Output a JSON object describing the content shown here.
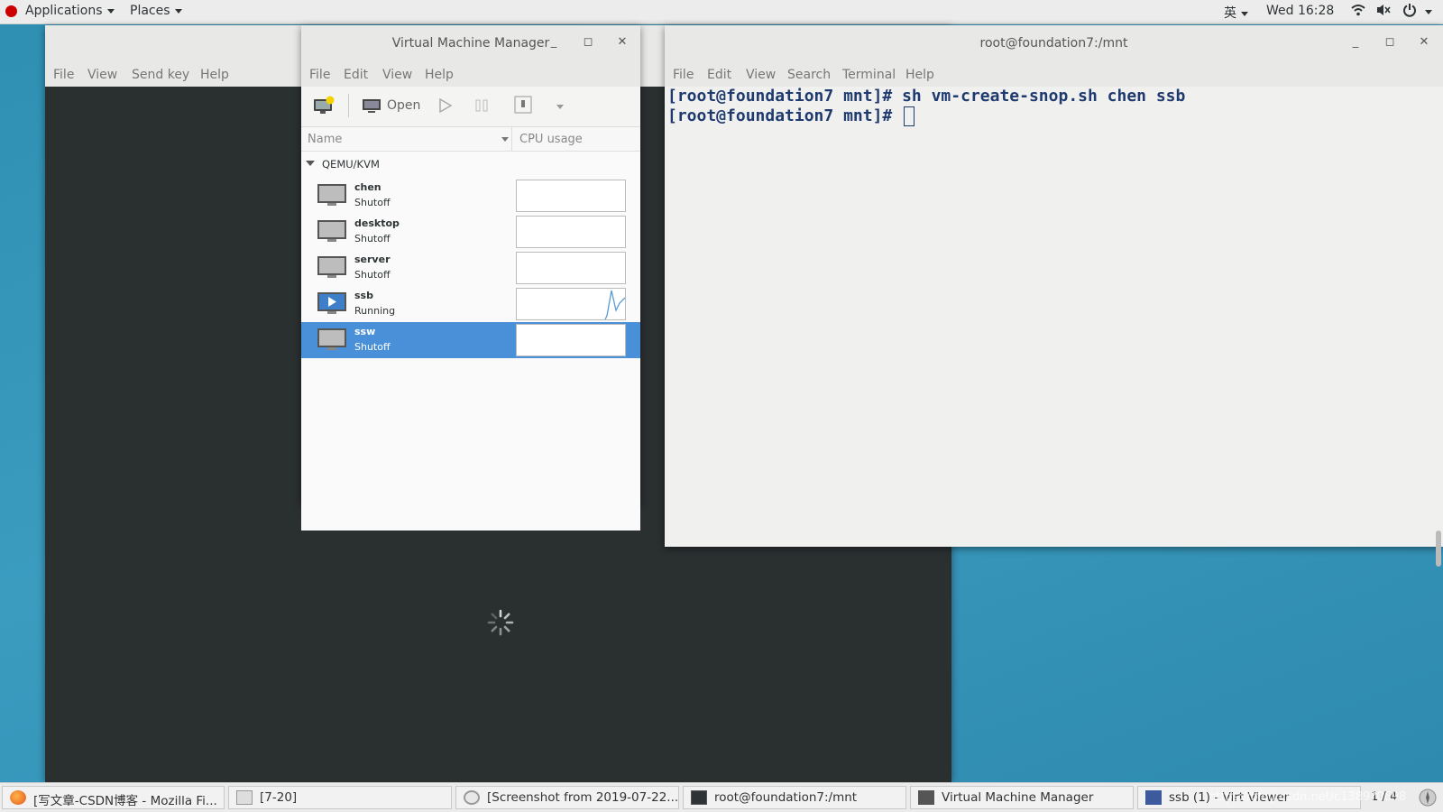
{
  "topbar": {
    "applications": "Applications",
    "places": "Places",
    "ime": "英",
    "clock": "Wed 16:28"
  },
  "viewer": {
    "menu": [
      "File",
      "View",
      "Send key",
      "Help"
    ]
  },
  "vmm": {
    "title": "Virtual Machine Manager",
    "menu": [
      "File",
      "Edit",
      "View",
      "Help"
    ],
    "toolbar": {
      "open_label": "Open"
    },
    "columns": {
      "name": "Name",
      "cpu": "CPU usage"
    },
    "group": "QEMU/KVM",
    "vms": [
      {
        "name": "chen",
        "status": "Shutoff"
      },
      {
        "name": "desktop",
        "status": "Shutoff"
      },
      {
        "name": "server",
        "status": "Shutoff"
      },
      {
        "name": "ssb",
        "status": "Running"
      },
      {
        "name": "ssw",
        "status": "Shutoff"
      }
    ]
  },
  "terminal": {
    "title": "root@foundation7:/mnt",
    "menu": [
      "File",
      "Edit",
      "View",
      "Search",
      "Terminal",
      "Help"
    ],
    "lines": [
      "[root@foundation7 mnt]# sh vm-create-snop.sh chen ssb",
      "[root@foundation7 mnt]# "
    ]
  },
  "taskbar": {
    "tasks": [
      "[写文章-CSDN博客 - Mozilla Fi...",
      "[7-20]",
      "[Screenshot from 2019-07-22...",
      "root@foundation7:/mnt",
      "Virtual Machine Manager",
      "ssb (1) - Virt Viewer"
    ],
    "workspace": "1 / 4",
    "watermark": "https://blog.csdn.net/c1389?0698"
  }
}
